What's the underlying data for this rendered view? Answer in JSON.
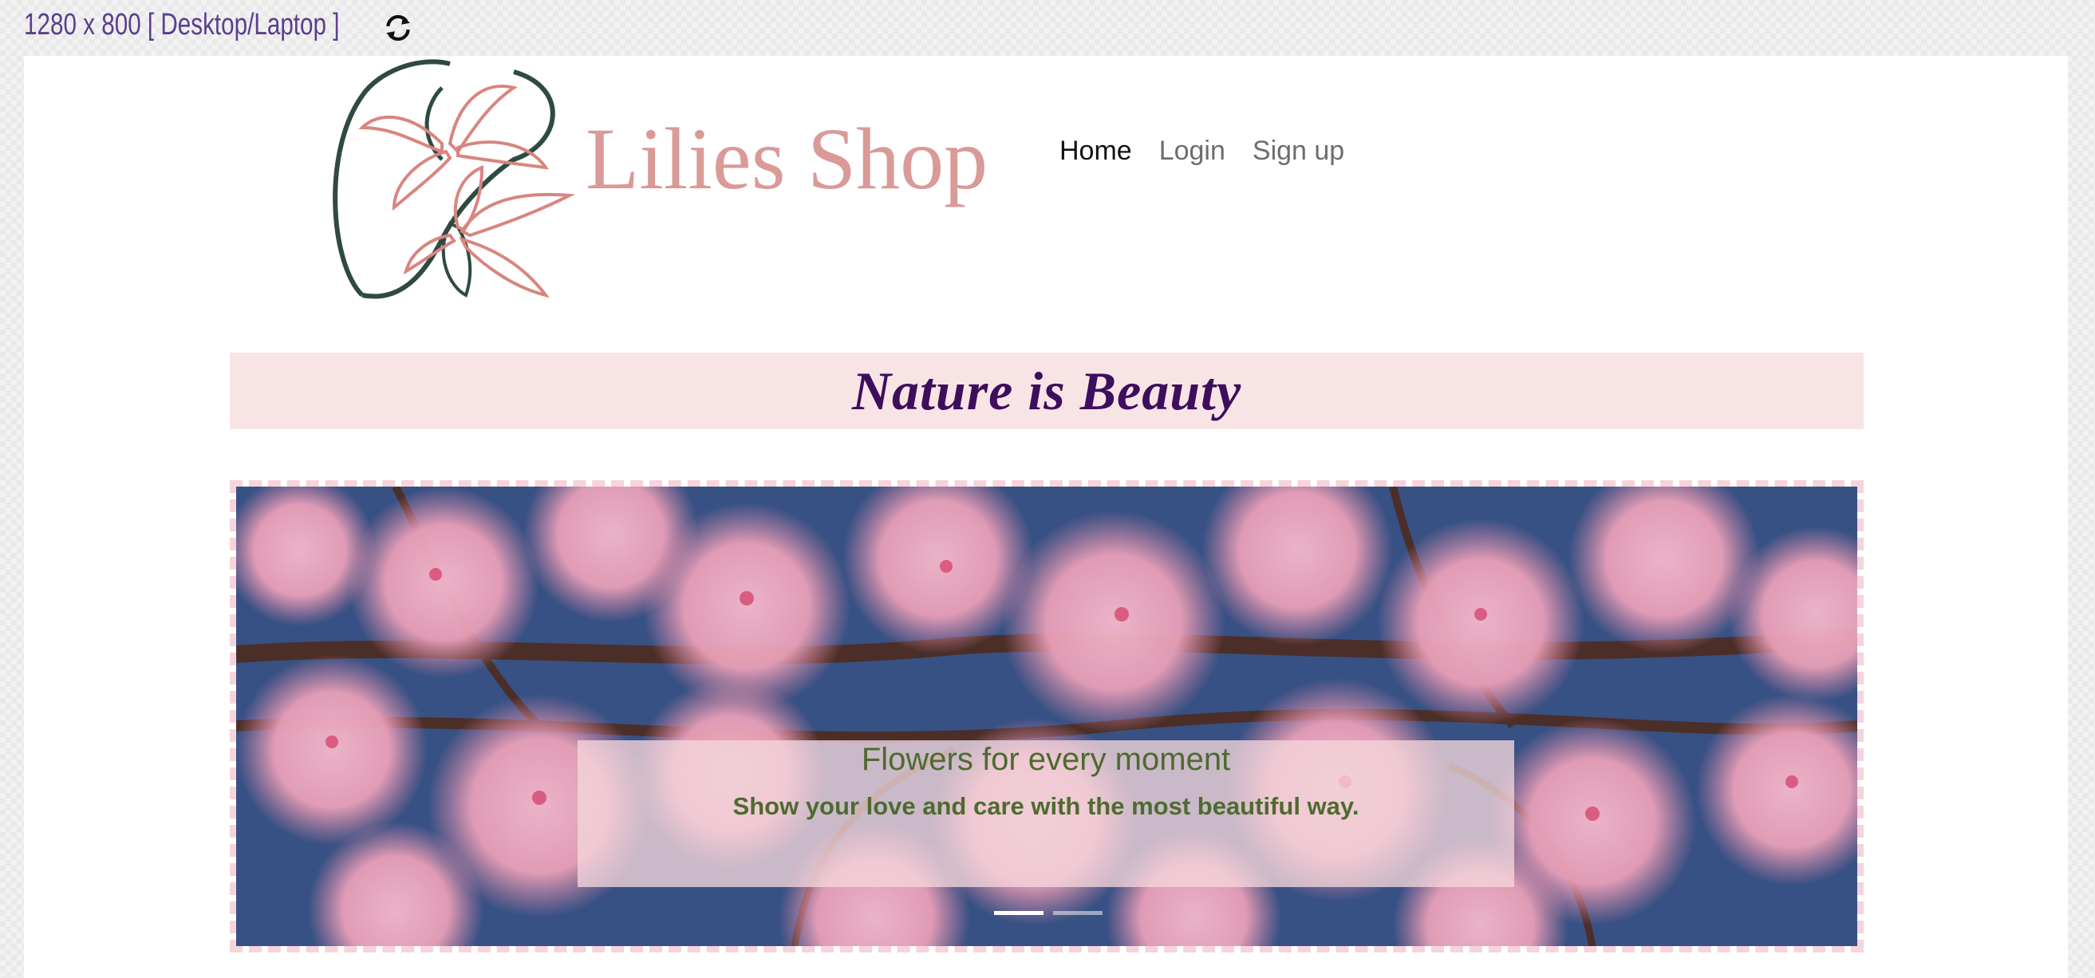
{
  "toolbar": {
    "resolution_label": "1280 x 800 [ Desktop/Laptop ]",
    "rotate_icon": "rotate-arrows-icon"
  },
  "site": {
    "logo_text": "Lilies Shop",
    "nav": {
      "items": [
        "Home",
        "Login",
        "Sign up"
      ],
      "active": "Home"
    },
    "tagline": "Nature is Beauty"
  },
  "carousel": {
    "caption_title": "Flowers for every moment",
    "caption_text": "Show your love and care with the most beautiful way.",
    "slide_count": 2,
    "active_slide": 1
  },
  "colors": {
    "brand_pink": "#d99a98",
    "tagline_purple": "#3d0e5c",
    "caption_green": "#4d6b2f",
    "band_pink": "#f9e4e5"
  }
}
